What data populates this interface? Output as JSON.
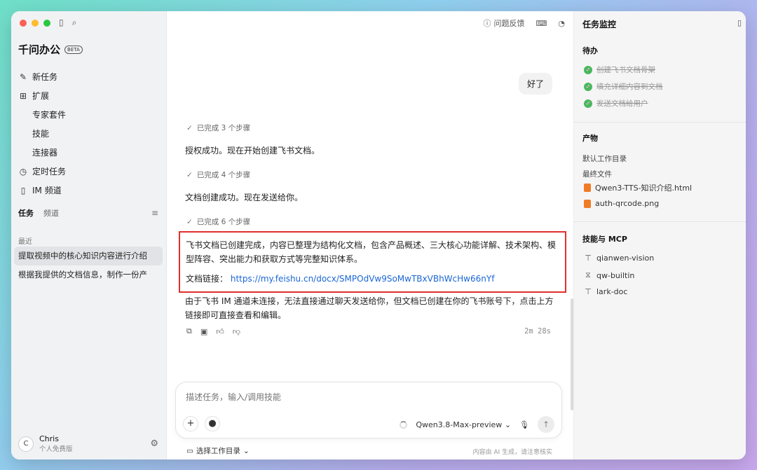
{
  "sidebar": {
    "brand": "千问办公",
    "beta": "BETA",
    "nav": [
      {
        "label": "新任务"
      },
      {
        "label": "扩展"
      },
      {
        "label": "专家套件"
      },
      {
        "label": "技能"
      },
      {
        "label": "连接器"
      },
      {
        "label": "定时任务"
      },
      {
        "label": "IM 频道"
      }
    ],
    "tabs": [
      {
        "label": "任务"
      },
      {
        "label": "频道"
      }
    ],
    "recent_label": "最近",
    "recent": [
      {
        "label": "提取视频中的核心知识内容进行介绍"
      },
      {
        "label": "根据我提供的文档信息，制作一份产"
      }
    ],
    "user": {
      "initial": "C",
      "name": "Chris",
      "plan": "个人免费版"
    }
  },
  "main": {
    "feedback": "问题反馈",
    "user_message": "好了",
    "steps": [
      "已完成 3 个步骤",
      "已完成 4 个步骤",
      "已完成 6 个步骤"
    ],
    "messages": [
      "授权成功。现在开始创建飞书文档。",
      "文档创建成功。现在发送给你。"
    ],
    "highlight_text": "飞书文档已创建完成，内容已整理为结构化文档，包含产品概述、三大核心功能详解、技术架构、模型阵容、突出能力和获取方式等完整知识体系。",
    "link_label": "文档链接：",
    "link_url": "https://my.feishu.cn/docx/SMPOdVw9SoMwTBxVBhWcHw66nYf",
    "after_text": "由于飞书 IM 通道未连接，无法直接通过聊天发送给你，但文档已创建在你的飞书账号下，点击上方链接即可直接查看和编辑。",
    "timer": "2m 28s",
    "composer_placeholder": "描述任务，输入/调用技能",
    "model": "Qwen3.8-Max-preview",
    "workspace": "选择工作目录",
    "disclaimer": "内容由 AI 生成，请注意核实"
  },
  "panel": {
    "title": "任务监控",
    "todo_title": "待办",
    "todos": [
      "创建飞书文档骨架",
      "填充详细内容到文档",
      "发送文档给用户"
    ],
    "artifacts_title": "产物",
    "default_dir": "默认工作目录",
    "final_files": "最终文件",
    "files": [
      "Qwen3-TTS-知识介绍.html",
      "auth-qrcode.png"
    ],
    "skills_title": "技能与 MCP",
    "skills": [
      "qianwen-vision",
      "qw-builtin",
      "lark-doc"
    ]
  },
  "colors": {
    "accent_link": "#1a66d6",
    "highlight_border": "#e0302d",
    "done_green": "#49b85c",
    "file_orange": "#f07b27"
  }
}
